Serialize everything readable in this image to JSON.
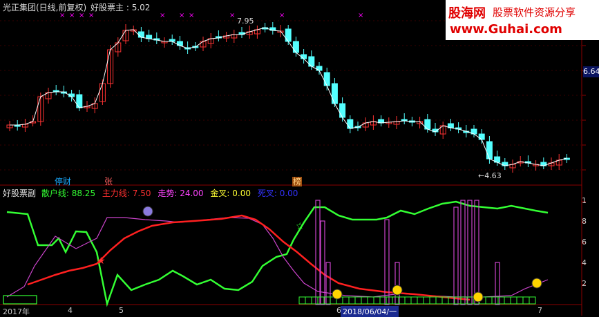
{
  "header": {
    "title": "光正集团(日线,前复权)",
    "indicator_name": "好股票主",
    "indicator_value": ": 5.02",
    "high_label": "7.95",
    "low_label": "4.63",
    "last_price": "6.64"
  },
  "banner": {
    "logo_text": "股海网",
    "slogan": "股票软件资源分享",
    "url": "www.Guhai.com"
  },
  "event_tags": [
    {
      "text": "停财",
      "color": "#19aaff"
    },
    {
      "text": "张",
      "color": "#ff6060"
    },
    {
      "text": "榜",
      "color": "#ffa040"
    }
  ],
  "sub_panel": {
    "name": "好股票副",
    "items": [
      {
        "label": "散户线",
        "value": "88.25",
        "color": "#33ff33"
      },
      {
        "label": "主力线",
        "value": "7.50",
        "color": "#ff3030"
      },
      {
        "label": "走势",
        "value": "24.00",
        "color": "#ff44ff"
      },
      {
        "label": "金叉",
        "value": "0.00",
        "color": "#ffff33"
      },
      {
        "label": "死叉",
        "value": "0.00",
        "color": "#3333ff"
      }
    ]
  },
  "x_axis": {
    "year": "2017年",
    "ticks": [
      "4",
      "5",
      "6",
      "7"
    ],
    "cursor_date": "2018/06/04/一"
  },
  "colors": {
    "up": "#ff3232",
    "down": "#54ffff",
    "marker": "#ff00ff",
    "bg": "#000000"
  }
}
